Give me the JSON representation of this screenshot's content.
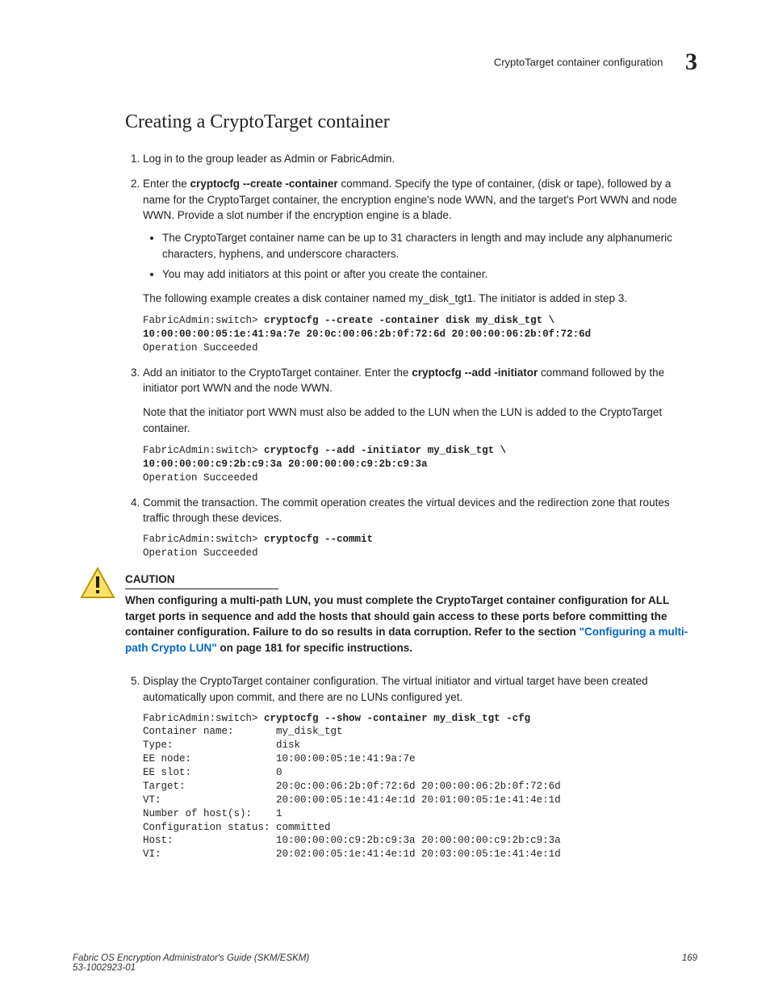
{
  "header": {
    "title": "CryptoTarget container configuration",
    "chapter": "3"
  },
  "section_heading": "Creating a CryptoTarget container",
  "steps": {
    "s1": "Log in to the group leader as Admin or FabricAdmin.",
    "s2_prefix": "Enter the ",
    "s2_cmd1": "cryptocfg",
    "s2_cmd2": "--create",
    "s2_cmd3": "-container",
    "s2_rest": " command. Specify the type of container, (disk or tape), followed by a name for the CryptoTarget container, the encryption engine's node WWN, and the target's Port WWN and node WWN. Provide a slot number if the encryption engine is a blade.",
    "s2_b1": "The CryptoTarget container name can be up to 31 characters in length and may include any alphanumeric characters, hyphens, and underscore characters.",
    "s2_b2": "You may add initiators at this point or after you create the container.",
    "s2_note": "The following example creates a disk container named my_disk_tgt1. The initiator is added in step 3.",
    "s2_code_prompt": "FabricAdmin:switch> ",
    "s2_code_bold1": "cryptocfg --create -container disk my_disk_tgt \\",
    "s2_code_bold2": "10:00:00:00:05:1e:41:9a:7e 20:0c:00:06:2b:0f:72:6d 20:00:00:06:2b:0f:72:6d",
    "s2_code_plain": "Operation Succeeded",
    "s3_prefix": "Add an initiator to the CryptoTarget container. Enter the ",
    "s3_cmd1": "cryptocfg",
    "s3_cmd2": "--add",
    "s3_cmd3": "-initiator",
    "s3_rest": " command followed by the initiator port WWN and the node WWN.",
    "s3_note": "Note that the initiator port WWN must also be added to the LUN when the LUN is added to the CryptoTarget container.",
    "s3_code_prompt": "FabricAdmin:switch> ",
    "s3_code_bold1": "cryptocfg --add -initiator my_disk_tgt \\",
    "s3_code_bold2": "10:00:00:00:c9:2b:c9:3a 20:00:00:00:c9:2b:c9:3a",
    "s3_code_plain": "Operation Succeeded",
    "s4": "Commit the transaction. The commit operation creates the virtual devices and the redirection zone that routes traffic through these devices.",
    "s4_code_prompt": "FabricAdmin:switch> ",
    "s4_code_bold": "cryptocfg --commit",
    "s4_code_plain": "Operation Succeeded",
    "s5": "Display the CryptoTarget container configuration. The virtual initiator and virtual target have been created automatically upon commit, and there are no LUNs configured yet.",
    "s5_code_prompt": "FabricAdmin:switch> ",
    "s5_code_bold": "cryptocfg --show -container my_disk_tgt -cfg",
    "s5_output": "Container name:       my_disk_tgt\nType:                 disk\nEE node:              10:00:00:05:1e:41:9a:7e\nEE slot:              0\nTarget:               20:0c:00:06:2b:0f:72:6d 20:00:00:06:2b:0f:72:6d\nVT:                   20:00:00:05:1e:41:4e:1d 20:01:00:05:1e:41:4e:1d\nNumber of host(s):    1\nConfiguration status: committed\nHost:                 10:00:00:00:c9:2b:c9:3a 20:00:00:00:c9:2b:c9:3a\nVI:                   20:02:00:05:1e:41:4e:1d 20:03:00:05:1e:41:4e:1d"
  },
  "caution": {
    "label": "CAUTION",
    "text_pre": "When configuring a multi-path LUN, you must complete the CryptoTarget container configuration for ALL target ports in sequence and add the hosts that should gain access to these ports before committing the container configuration. Failure to do so results in data corruption. Refer to the section ",
    "link": "\"Configuring a multi-path Crypto LUN\"",
    "text_post": " on page 181 for specific instructions."
  },
  "footer": {
    "left_line1": "Fabric OS Encryption Administrator's Guide (SKM/ESKM)",
    "left_line2": "53-1002923-01",
    "page": "169"
  }
}
